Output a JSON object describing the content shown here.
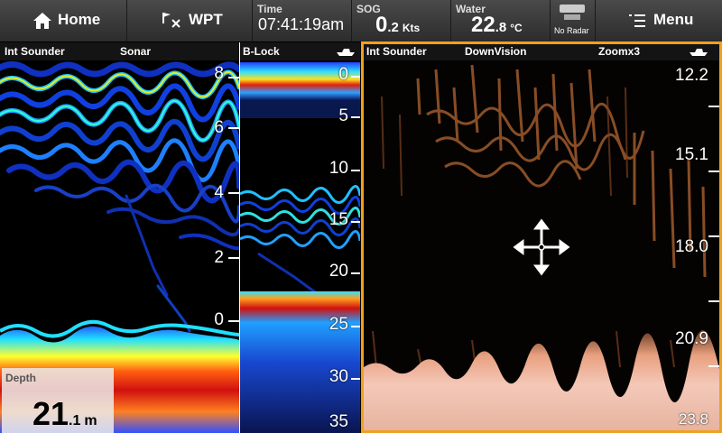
{
  "topbar": {
    "home_label": "Home",
    "wpt_label": "WPT",
    "time_caption": "Time",
    "time_value": "07:41:19am",
    "sog_caption": "SOG",
    "sog_int": "0",
    "sog_dec": ".2",
    "sog_unit": "Kts",
    "water_caption": "Water",
    "water_int": "22",
    "water_dec": ".8",
    "water_unit": "°C",
    "radar_label": "No Radar",
    "menu_label": "Menu"
  },
  "sonar_panel": {
    "source": "Int Sounder",
    "mode": "Sonar",
    "scale": [
      "8",
      "6",
      "4",
      "2",
      "0"
    ]
  },
  "block_panel": {
    "title": "B-Lock",
    "scale": [
      "0",
      "5",
      "10",
      "15",
      "20",
      "25",
      "30",
      "35"
    ]
  },
  "downvision_panel": {
    "source": "Int Sounder",
    "mode": "DownVision",
    "zoom": "Zoomx3",
    "scale": [
      "12.2",
      "15.1",
      "18.0",
      "20.9",
      "23.8"
    ]
  },
  "depth": {
    "caption": "Depth",
    "int": "21",
    "dec": ".1",
    "unit": "m"
  },
  "colors": {
    "accent": "#f0a020",
    "topbar": "#3a3a3a"
  }
}
